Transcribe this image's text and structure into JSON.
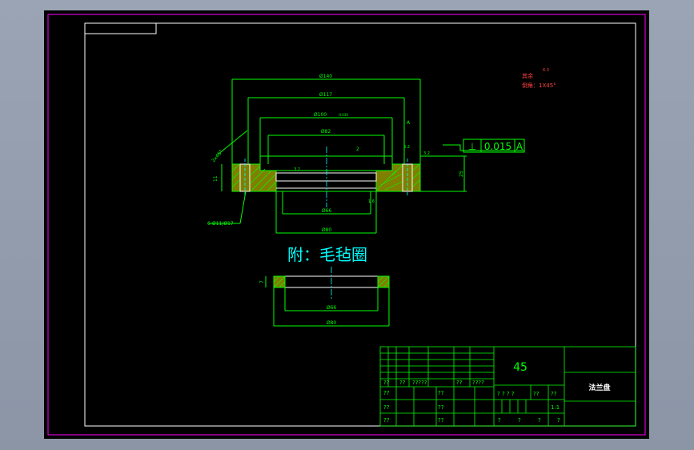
{
  "drawing": {
    "accessory_title": "附：毛毡圈",
    "material": "45",
    "part_name": "法兰盘",
    "roughness_note": "其余",
    "roughness_value": "6.3",
    "chamfer_note": "倒角：1X45°",
    "tolerance_frame": {
      "symbol": "⊥",
      "value": "0.015",
      "datum": "A"
    }
  },
  "dimensions": {
    "d140": "Ø140",
    "d117": "Ø117",
    "d100": "Ø100",
    "d100_tol": "-0.036",
    "d82": "Ø82",
    "d66": "Ø66",
    "d80": "Ø80",
    "holes": "6-Ø11/Ø17",
    "h11": "11",
    "h25": "25",
    "h7": "7",
    "r2": "2",
    "chamfer45": "2x45°",
    "felt_d66": "Ø66",
    "felt_d80": "Ø80",
    "felt_h7": "7",
    "datum_a": "A",
    "roughness_a": "3.2",
    "roughness_b": "3.2",
    "roughness_c": "3.2",
    "roughness_d": "1.6"
  },
  "title_block": {
    "row_a": [
      "??",
      "??",
      "?????",
      "??",
      "????"
    ],
    "row_b": [
      "??",
      "??"
    ],
    "row_c": [
      "??",
      "??"
    ],
    "row_d": [
      "??",
      "??"
    ],
    "mid_a": [
      "? ? ? ?",
      "??",
      "??"
    ],
    "mid_b": [
      "1:1"
    ],
    "mid_c": [
      "?",
      "?",
      "?",
      "?"
    ]
  },
  "colors": {
    "background": "#000000",
    "line": "#00ff00",
    "border": "#ffffff",
    "frame": "#ff00ff",
    "accent": "#00ffff",
    "note": "#ff4040"
  }
}
